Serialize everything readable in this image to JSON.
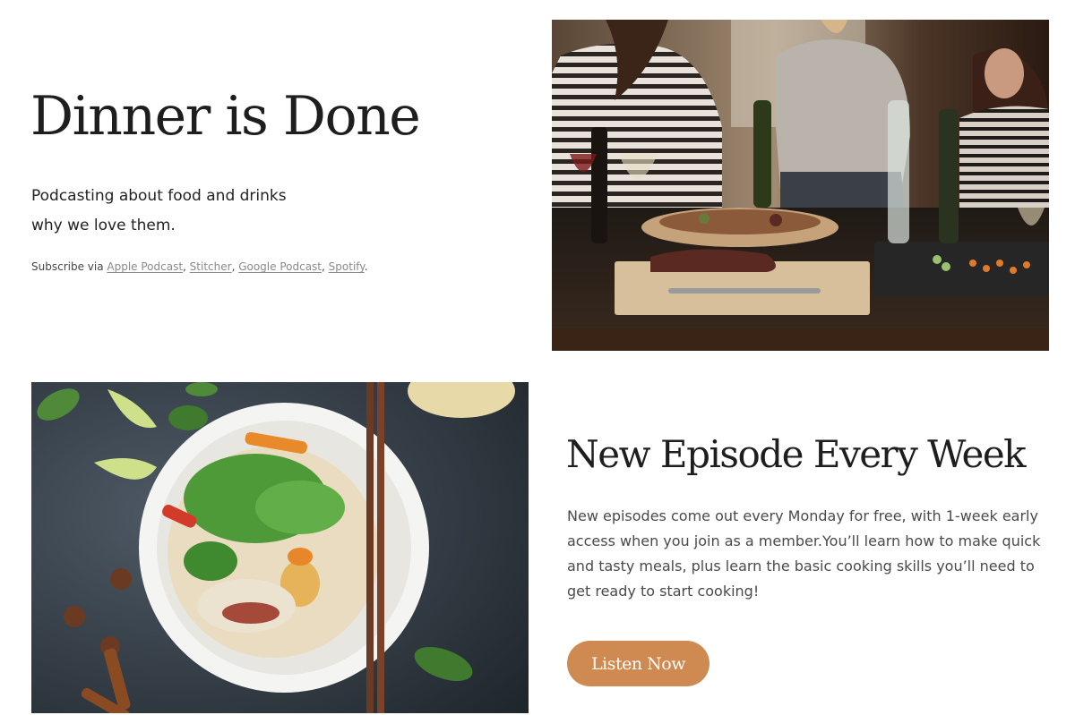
{
  "hero": {
    "title": "Dinner is Done",
    "tagline_line1": "Podcasting about food and drinks",
    "tagline_line2": "why we love them.",
    "subscribe_prefix": "Subscribe via ",
    "links": [
      "Apple Podcast",
      "Stitcher",
      "Google Podcast",
      "Spotify"
    ],
    "separator": ", ",
    "suffix": "."
  },
  "episode": {
    "title": "New Episode Every Week",
    "body": "New episodes come out every Monday for free, with 1-week early access when you join as a member.You’ll learn how to make quick and tasty meals, plus learn the basic cooking skills you’ll need to get ready to start cooking!",
    "button_label": "Listen Now"
  },
  "colors": {
    "accent": "#cf8a52",
    "title": "#1e1e1e",
    "body_text": "#4a4a4a",
    "link": "#8a8a8a"
  }
}
